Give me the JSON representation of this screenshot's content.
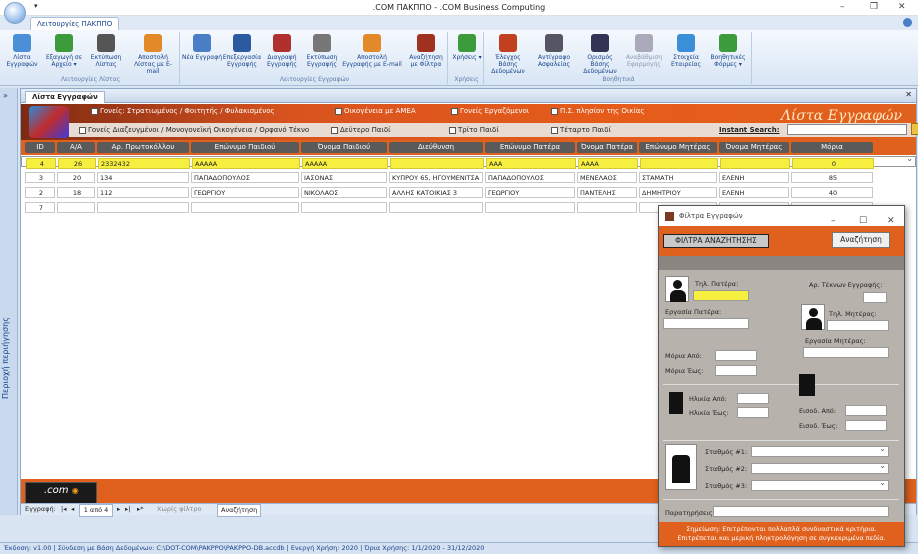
{
  "window": {
    "title": ".COM ΠΑΚΠΠΟ - .COM Business Computing"
  },
  "ribbon": {
    "tab": "Λειτουργίες ΠΑΚΠΠΟ",
    "groups": [
      {
        "label": "Λειτουργίες Λίστας",
        "buttons": [
          "Λίστα Εγγραφών",
          "Εξαγωγή σε Αρχείο ▾",
          "Εκτύπωση Λίστας",
          "Αποστολή Λίστας με E-mail"
        ]
      },
      {
        "label": "Λειτουργίες Εγγραφών",
        "buttons": [
          "Νέα Εγγραφή",
          "Επεξεργασία Εγγραφής",
          "Διαγραφή Εγγραφής",
          "Εκτύπωση Εγγραφής",
          "Αποστολή Εγγραφής με E-mail",
          "Αναζήτηση με Φίλτρα"
        ]
      },
      {
        "label": "Χρήσεις",
        "buttons": [
          "Χρήσεις ▾"
        ]
      },
      {
        "label": "Βοηθητικά",
        "buttons": [
          "Έλεγχος Βάσης Δεδομένων",
          "Αντίγραφο Ασφαλείας",
          "Ορισμός Βάσης Δεδομένων",
          "Αναβάθμιση Εφαρμογής",
          "Στοιχεία Εταιρείας",
          "Βοηθητικές Φόρμες ▾"
        ]
      }
    ]
  },
  "side_panel": {
    "label": "Περιοχή περιήγησης"
  },
  "doc": {
    "tab": "Λίστα Εγγραφών",
    "big_title": "Λίστα Εγγραφών",
    "checkboxes_row1": [
      "Γονείς: Στρατιωμένος / Φοιτητής / Φυλακισμένος",
      "Οικογένεια με ΑΜΕΑ",
      "Γονείς Εργαζόμενοι",
      "Π.Σ. πλησίον της Οικίας"
    ],
    "checkboxes_row2": [
      "Γονείς Διαζευγμένοι / Μονογονεϊκή Οικογένεια / Ορφανό Τέκνο",
      "Δεύτερο Παιδί",
      "Τρίτο Παιδί",
      "Τέταρτο Παιδί"
    ],
    "instant_search_label": "Instant Search:"
  },
  "grid": {
    "columns": [
      "ID",
      "Α/Α",
      "Αρ. Πρωτοκόλλου",
      "Επώνυμο Παιδιού",
      "Όνομα Παιδιού",
      "Διεύθυνση",
      "Επώνυμο Πατέρα",
      "Όνομα Πατέρα",
      "Επώνυμο Μητέρας",
      "Όνομα Μητέρας",
      "Μόρια"
    ],
    "rows": [
      [
        "4",
        "26",
        "2332432",
        "ΑΑΑΑΑ",
        "ΑΑΑΑΑ",
        "",
        "ΑΑΑ",
        "ΑΑΑΑ",
        "",
        "",
        "0"
      ],
      [
        "3",
        "20",
        "134",
        "ΠΑΠΑΔΟΠΟΥΛΟΣ",
        "ΙΑΣΟΝΑΣ",
        "ΚΥΠΡΟΥ 65, ΗΓΟΥΜΕΝΙΤΣΑ",
        "ΠΑΠΑΔΟΠΟΥΛΟΣ",
        "ΜΕΝΕΛΑΟΣ",
        "ΣΤΑΜΑΤΗ",
        "ΕΛΕΝΗ",
        "85"
      ],
      [
        "2",
        "18",
        "112",
        "ΓΕΩΡΓΙΟΥ",
        "ΝΙΚΟΛΑΟΣ",
        "ΑΛΛΗΣ ΚΑΤΟΙΚΙΑΣ 3",
        "ΓΕΩΡΓΙΟΥ",
        "ΠΑΝΤΕΛΗΣ",
        "ΔΗΜΗΤΡΙΟΥ",
        "ΕΛΕΝΗ",
        "40"
      ],
      [
        "7",
        "",
        "",
        "",
        "",
        "",
        "",
        "",
        "",
        "",
        ""
      ]
    ]
  },
  "brand": {
    "text": ".com"
  },
  "nav": {
    "record_label": "Εγγραφή:",
    "position": "1 από 4",
    "filter": "Χωρίς φίλτρο",
    "search": "Αναζήτηση"
  },
  "status": {
    "text": "Έκδοση: v1.00  |  Σύνδεση με Βάση Δεδομένων: C:\\DOT-COM\\PAKPPO\\PAKPPO-DB.accdb  |  Ενεργή Χρήση: 2020  |  Όρια Χρήσης: 1/1/2020 - 31/12/2020"
  },
  "dialog": {
    "title": "Φίλτρα Εγγραφών",
    "filters_label": "ΦΙΛΤΡΑ ΑΝΑΖΗΤΗΣΗΣ",
    "search_button": "Αναζήτηση",
    "father_phone": "Τηλ. Πατέρα:",
    "children_count": "Αρ. Τέκνων Εγγραφής:",
    "father_job": "Εργασία Πατέρα:",
    "mother_phone": "Τηλ. Μητέρας:",
    "mother_job": "Εργασία Μητέρας:",
    "points_from": "Μόρια Από:",
    "points_to": "Μόρια Έως:",
    "age_from": "Ηλικία Από:",
    "age_to": "Ηλικία Έως:",
    "income_from": "Εισοδ. Από:",
    "income_to": "Εισοδ. Έως:",
    "station1": "Σταθμός #1:",
    "station2": "Σταθμός #2:",
    "station3": "Σταθμός #3:",
    "notes": "Παρατηρήσεις:",
    "note_line1": "Σημείωση: Επιτρέπονται πολλαπλά συνδυαστικά κριτήρια.",
    "note_line2": "Επιτρέπεται και μερική πληκτρολόγηση σε συγκεκριμένα πεδία."
  },
  "colors": {
    "accent": "#e0601d",
    "header_dark": "#5a5a5a",
    "selected_row": "#f7ef40"
  }
}
